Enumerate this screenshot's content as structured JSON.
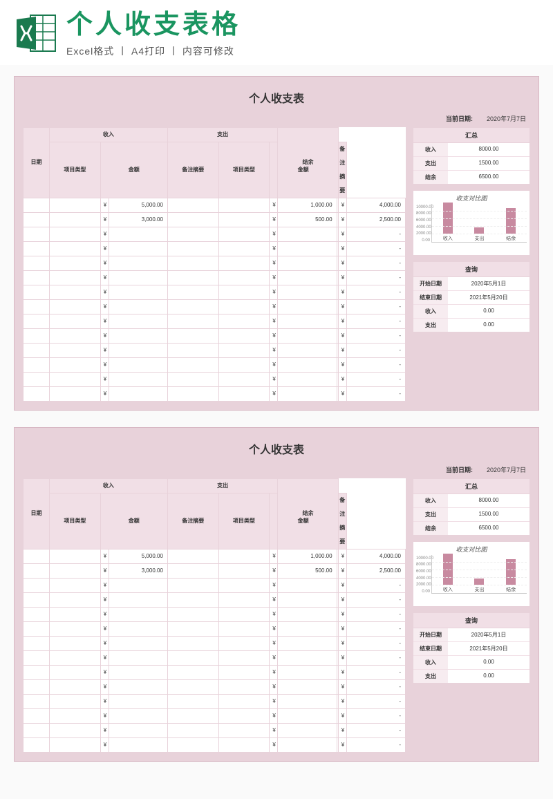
{
  "header": {
    "title": "个人收支表格",
    "subtitle": "Excel格式 丨 A4打印 丨 内容可修改"
  },
  "sheet": {
    "title": "个人收支表",
    "current_date_label": "当前日期:",
    "current_date_value": "2020年7月7日",
    "headers": {
      "date": "日期",
      "income_group": "收入",
      "expense_group": "支出",
      "item_type": "项目类型",
      "amount": "金额",
      "remark": "备注摘要",
      "balance": "结余"
    },
    "currency": "¥",
    "rows": [
      {
        "income_amount": "5,000.00",
        "expense_amount": "1,000.00",
        "balance": "4,000.00"
      },
      {
        "income_amount": "3,000.00",
        "expense_amount": "500.00",
        "balance": "2,500.00"
      },
      {
        "income_amount": "",
        "expense_amount": "",
        "balance": "-"
      },
      {
        "income_amount": "",
        "expense_amount": "",
        "balance": "-"
      },
      {
        "income_amount": "",
        "expense_amount": "",
        "balance": "-"
      },
      {
        "income_amount": "",
        "expense_amount": "",
        "balance": "-"
      },
      {
        "income_amount": "",
        "expense_amount": "",
        "balance": "-"
      },
      {
        "income_amount": "",
        "expense_amount": "",
        "balance": "-"
      },
      {
        "income_amount": "",
        "expense_amount": "",
        "balance": "-"
      },
      {
        "income_amount": "",
        "expense_amount": "",
        "balance": "-"
      },
      {
        "income_amount": "",
        "expense_amount": "",
        "balance": "-"
      },
      {
        "income_amount": "",
        "expense_amount": "",
        "balance": "-"
      },
      {
        "income_amount": "",
        "expense_amount": "",
        "balance": "-"
      },
      {
        "income_amount": "",
        "expense_amount": "",
        "balance": "-"
      }
    ],
    "summary": {
      "title": "汇总",
      "income_label": "收入",
      "income_value": "8000.00",
      "expense_label": "支出",
      "expense_value": "1500.00",
      "balance_label": "结余",
      "balance_value": "6500.00"
    },
    "query": {
      "title": "查询",
      "start_label": "开始日期",
      "start_value": "2020年5月1日",
      "end_label": "结束日期",
      "end_value": "2021年5月20日",
      "income_label": "收入",
      "income_value": "0.00",
      "expense_label": "支出",
      "expense_value": "0.00"
    }
  },
  "chart_data": {
    "type": "bar",
    "title": "收支对比图",
    "categories": [
      "收入",
      "支出",
      "结余"
    ],
    "values": [
      8000,
      1500,
      6500
    ],
    "ylim": [
      0,
      10000
    ],
    "yticks": [
      "10000.00",
      "8000.00",
      "6000.00",
      "4000.00",
      "2000.00",
      "0.00"
    ],
    "bar_color": "#c88aa0"
  }
}
